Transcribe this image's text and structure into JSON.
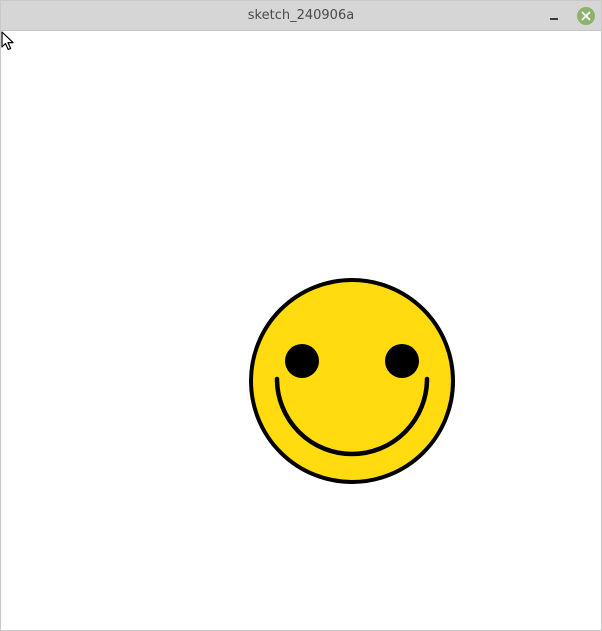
{
  "window": {
    "title": "sketch_240906a"
  },
  "icons": {
    "minimize": "minimize-icon",
    "close": "close-icon",
    "cursor": "pointer-cursor-icon"
  },
  "colors": {
    "titlebar": "#d6d6d6",
    "close_button": "#8cb26d",
    "face_fill": "#ffdb0f",
    "outline": "#000000",
    "canvas_background": "#ffffff"
  }
}
